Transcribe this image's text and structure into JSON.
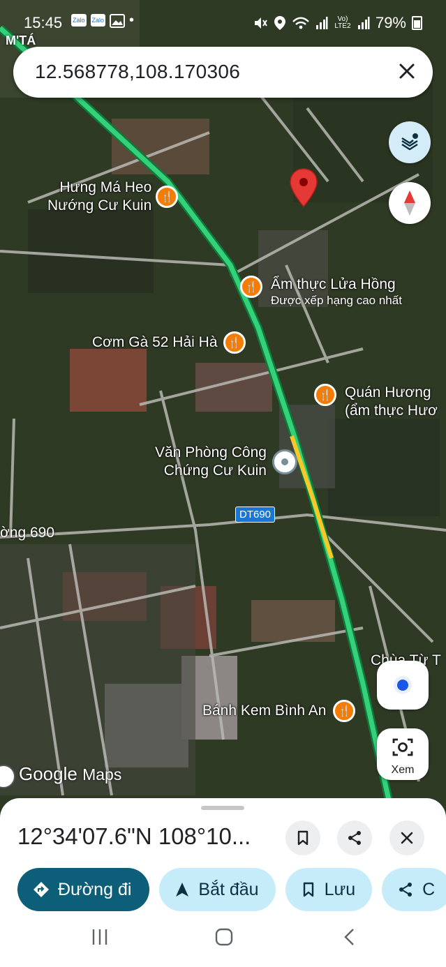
{
  "status_bar": {
    "time": "15:45",
    "app_icons": [
      "Zalo",
      "Zalo"
    ],
    "network_lte": "Vo) LTE2",
    "battery": "79%"
  },
  "search": {
    "query": "12.568778,108.170306"
  },
  "map": {
    "area_label": "M'TÁ",
    "pois": [
      {
        "name": "Hưng Má Heo Nướng Cư Kuin",
        "line1": "Hưng Má Heo",
        "line2": "Nướng Cư Kuin",
        "icon": "restaurant-icon"
      },
      {
        "name": "Ẩm thực Lửa Hồng",
        "line1": "Ẩm thực Lửa Hồng",
        "sub": "Được xếp hạng cao nhất",
        "icon": "restaurant-icon"
      },
      {
        "name": "Cơm Gà 52 Hải Hà",
        "line1": "Cơm Gà 52 Hải Hà",
        "icon": "restaurant-icon"
      },
      {
        "name": "Quán Hương (ẩm thực Hươ",
        "line1": "Quán Hương",
        "line2": "(ẩm thực Hươ",
        "icon": "restaurant-icon"
      },
      {
        "name": "Văn Phòng Công Chứng Cư Kuin",
        "line1": "Văn Phòng Công",
        "line2": "Chứng Cư Kuin",
        "icon": "office-icon"
      },
      {
        "name": "Bánh Kem Bình An",
        "line1": "Bánh Kem Bình An",
        "icon": "restaurant-icon"
      },
      {
        "name": "Chùa Từ T",
        "line1": "Chùa Từ T"
      }
    ],
    "road_label": "ờng 690",
    "route_badge": "DT690",
    "logo_google": "Google",
    "logo_maps": "Maps",
    "colors": {
      "route": "#34d17a",
      "pin": "#e53935",
      "poi": "#f57c00"
    }
  },
  "buttons": {
    "layers": "layers-icon",
    "compass": "compass-icon",
    "my_location": "my-location-icon",
    "lens_label": "Xem"
  },
  "sheet": {
    "coordinates": "12°34'07.6\"N 108°10...",
    "chips": [
      {
        "label": "Đường đi",
        "icon": "directions-icon"
      },
      {
        "label": "Bắt đầu",
        "icon": "navigation-icon"
      },
      {
        "label": "Lưu",
        "icon": "bookmark-icon"
      },
      {
        "label": "C",
        "icon": "share-icon"
      }
    ]
  }
}
